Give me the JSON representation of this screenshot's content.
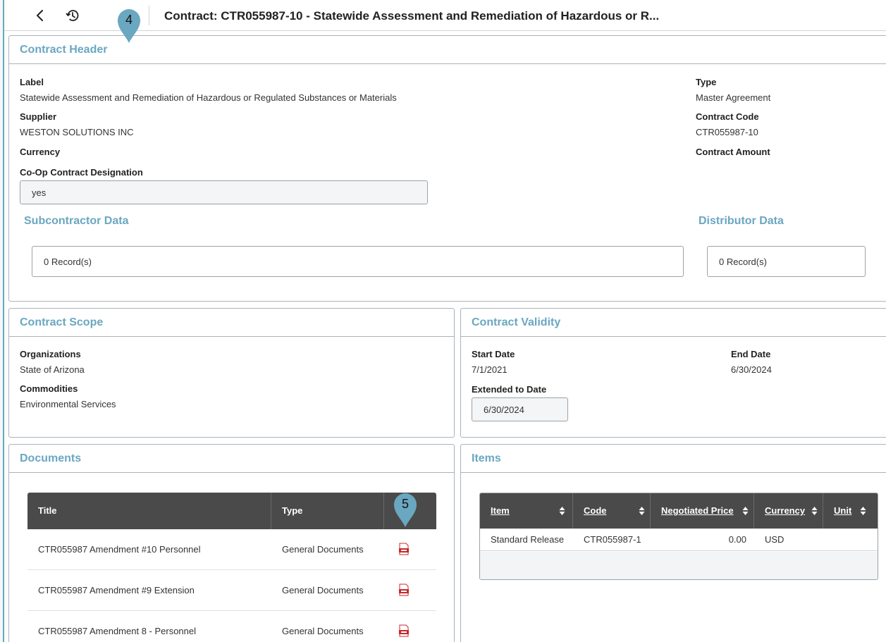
{
  "header": {
    "title": "Contract: CTR055987-10 - Statewide Assessment and Remediation of Hazardous or R...",
    "back_icon": "chevron-left-icon",
    "history_icon": "history-icon"
  },
  "markers": {
    "first": "4",
    "second": "5"
  },
  "contract_header": {
    "title": "Contract Header",
    "label_label": "Label",
    "label_value": "Statewide Assessment and Remediation of Hazardous or Regulated Substances or Materials",
    "supplier_label": "Supplier",
    "supplier_value": "WESTON SOLUTIONS INC",
    "currency_label": "Currency",
    "coop_label": "Co-Op Contract Designation",
    "coop_value": "yes",
    "type_label": "Type",
    "type_value": "Master Agreement",
    "code_label": "Contract Code",
    "code_value": "CTR055987-10",
    "amount_label": "Contract Amount",
    "subcontractor_title": "Subcontractor Data",
    "subcontractor_records": "0 Record(s)",
    "distributor_title": "Distributor Data",
    "distributor_records": "0 Record(s)"
  },
  "scope": {
    "title": "Contract Scope",
    "organizations_label": "Organizations",
    "organizations_value": "State of Arizona",
    "commodities_label": "Commodities",
    "commodities_value": "Environmental Services"
  },
  "validity": {
    "title": "Contract Validity",
    "start_label": "Start Date",
    "start_value": "7/1/2021",
    "end_label": "End Date",
    "end_value": "6/30/2024",
    "extended_label": "Extended to Date",
    "extended_value": "6/30/2024"
  },
  "documents": {
    "title": "Documents",
    "columns": [
      "Title",
      "Type",
      ""
    ],
    "rows": [
      {
        "title": "CTR055987 Amendment #10 Personnel",
        "type": "General Documents"
      },
      {
        "title": "CTR055987 Amendment #9 Extension",
        "type": "General Documents"
      },
      {
        "title": "CTR055987 Amendment 8 - Personnel",
        "type": "General Documents"
      }
    ],
    "file_icon": "pdf-icon"
  },
  "items": {
    "title": "Items",
    "columns": [
      "Item",
      "Code",
      "Negotiated Price",
      "Currency",
      "Unit"
    ],
    "rows": [
      {
        "item": "Standard Release",
        "code": "CTR055987-1",
        "price": "0.00",
        "currency": "USD",
        "unit": ""
      }
    ]
  },
  "colors": {
    "accent": "#6aa7c1",
    "marker": "#6aa7c1",
    "table_header": "#4a4a4a",
    "pdf": "#c8282c"
  }
}
